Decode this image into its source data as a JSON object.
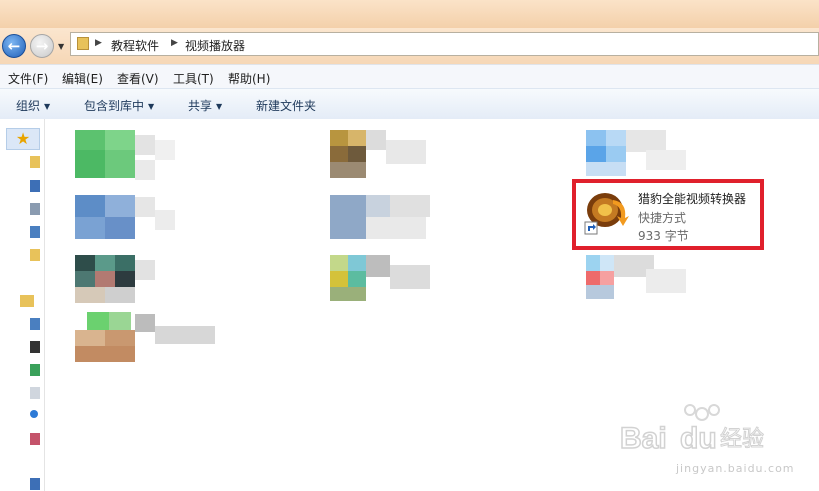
{
  "breadcrumb": [
    "教程软件",
    "视频播放器"
  ],
  "menu": [
    "文件(F)",
    "编辑(E)",
    "查看(V)",
    "工具(T)",
    "帮助(H)"
  ],
  "toolbar": [
    {
      "label": "组织",
      "dropdown": true
    },
    {
      "label": "包含到库中",
      "dropdown": true
    },
    {
      "label": "共享",
      "dropdown": true
    },
    {
      "label": "新建文件夹",
      "dropdown": false
    }
  ],
  "selected_item": {
    "name": "猎豹全能视频转换器",
    "type": "快捷方式",
    "size": "933 字节"
  },
  "watermark": {
    "brand": "Bai",
    "suffix": "经验",
    "url": "jingyan.baidu.com"
  },
  "icons": {
    "back": "back-arrow-icon",
    "forward": "forward-arrow-icon",
    "favorites": "star-icon",
    "folder": "folder-icon",
    "app": "video-converter-icon",
    "shortcut": "shortcut-arrow-icon"
  }
}
